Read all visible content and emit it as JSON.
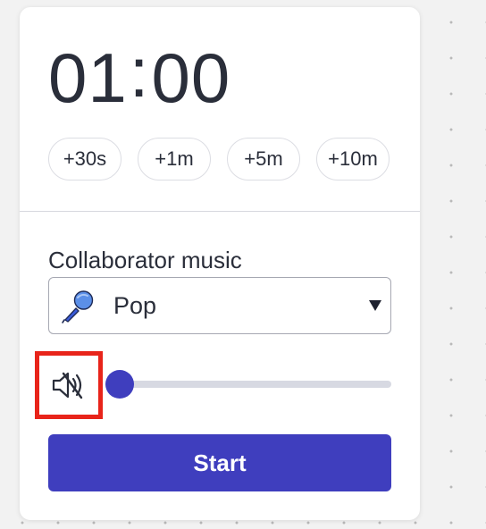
{
  "timer": {
    "minutes": "01",
    "separator": ":",
    "seconds": "00"
  },
  "increments": [
    "+30s",
    "+1m",
    "+5m",
    "+10m"
  ],
  "music": {
    "label": "Collaborator music",
    "selected": "Pop",
    "selected_icon": "microphone-icon"
  },
  "volume": {
    "muted": true,
    "level": 0.05,
    "icon": "speaker-muted-icon"
  },
  "start_label": "Start",
  "colors": {
    "accent": "#3f3ebe",
    "highlight": "#e8241a",
    "text": "#2a2e3a"
  }
}
